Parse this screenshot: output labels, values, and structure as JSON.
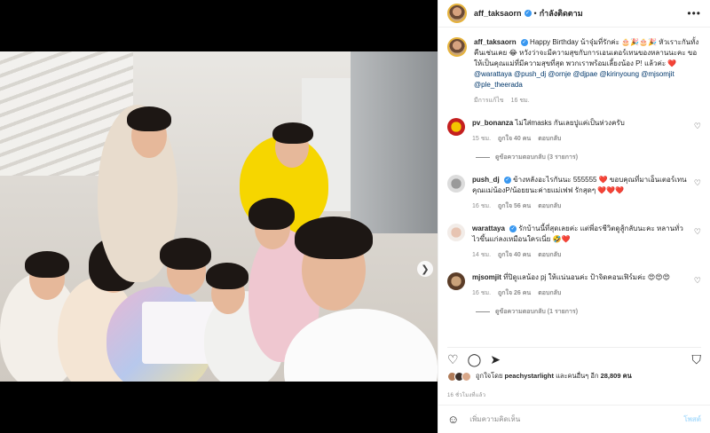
{
  "post": {
    "username": "aff_taksaorn",
    "follow_label": "กำลังติดตาม",
    "caption_text": "Happy Birthday น้าจุ๋มที่รักค่ะ 🎂🎉🎂🎉 หัวเราะกันทั้งคืนเช่นเคย 😂 หวังว่าจะมีความสุขกับการเอนเตอร์เทนของหลานนะคะ ขอให้เป็นคุณแม่ที่มีความสุขที่สุด พวกเราพร้อมเลี้ยงน้อง P! แล้วค่ะ ❤️",
    "caption_mentions": "@warattaya @push_dj @ornje @djpae @kirinyoung @mjsomjit @ple_theerada",
    "caption_meta_label": "มีการแก้ไข",
    "caption_meta_time": "16 ชม."
  },
  "comments": [
    {
      "username": "pv_bonanza",
      "text": "ไม่ใส่masks กันเลยปูแค่เป็นห่วงครับ",
      "time": "15 ชม.",
      "likes": "ถูกใจ 40 คน",
      "reply": "ตอบกลับ",
      "replies": "ดูข้อความตอบกลับ (3 รายการ)"
    },
    {
      "username": "push_dj",
      "text": "ข้างหลังอะไรกันนะ 555555 ❤️ ขอบคุณที่มาเอ็นเตอร์เทนคุณแม่น้องP/น้อยยนะค่ายแม่เฟฟ รักสุดๆ ❤️❤️❤️",
      "time": "16 ชม.",
      "likes": "ถูกใจ 56 คน",
      "reply": "ตอบกลับ"
    },
    {
      "username": "warattaya",
      "text": "รักบ้านนี้ที่สุดเลยค่ะ แต่พี่อรชีวิตดูสู้กลับนะคะ หลานทั่วไวขึ้นแก่ลงเหมือนใครเนี่ย 🤣❤️",
      "time": "14 ชม.",
      "likes": "ถูกใจ 40 คน",
      "reply": "ตอบกลับ"
    },
    {
      "username": "mjsomjit",
      "text": "ที่ปิดูแลน้อง pj ให้แน่นอนค่ะ ป้าจิดคอนเฟิร์มค่ะ 😍😍😍",
      "time": "16 ชม.",
      "likes": "ถูกใจ 26 คน",
      "reply": "ตอบกลับ",
      "replies": "ดูข้อความตอบกลับ (1 รายการ)"
    }
  ],
  "likes_line": {
    "prefix": "ถูกใจโดย",
    "user": "peachystarlight",
    "middle": "และคนอื่นๆ อีก",
    "count": "28,809",
    "suffix": "คน"
  },
  "time_ago": "16 ชั่วโมงที่แล้ว",
  "add_comment": {
    "placeholder": "เพิ่มความคิดเห็น",
    "post_label": "โพสต์"
  },
  "colors": {
    "accent": "#3897f0",
    "post_disabled": "#b2dffc",
    "muted": "#8e8e8e",
    "text": "#262626"
  },
  "icons": [
    "more-icon",
    "heart-icon",
    "comment-icon",
    "share-icon",
    "bookmark-icon",
    "emoji-icon",
    "next-arrow-icon",
    "verified-icon"
  ]
}
